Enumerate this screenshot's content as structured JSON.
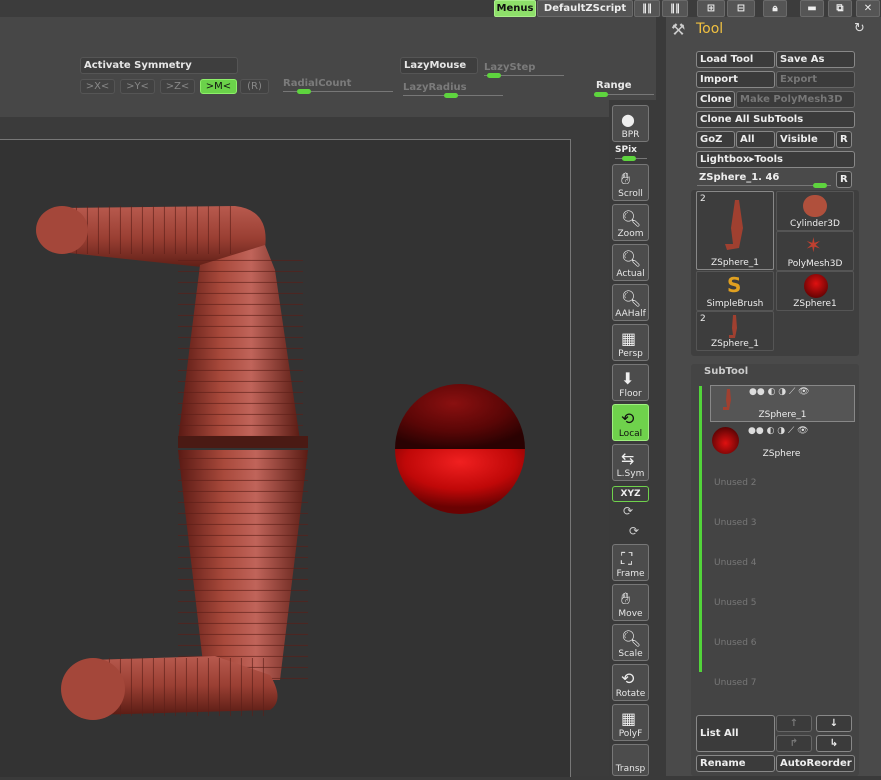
{
  "topbar": {
    "menus": "Menus",
    "script": "DefaultZScript"
  },
  "shelf": {
    "activate_symmetry": "Activate Symmetry",
    "sym_x": ">X<",
    "sym_y": ">Y<",
    "sym_z": ">Z<",
    "sym_m": ">M<",
    "sym_r": "(R)",
    "radial_count": "RadialCount",
    "lazymouse": "LazyMouse",
    "lazystep": "LazyStep",
    "lazyradius": "LazyRadius",
    "range": "Range"
  },
  "right_toolbar": {
    "bpr": "BPR",
    "spix": "SPix",
    "scroll": "Scroll",
    "zoom": "Zoom",
    "actual": "Actual",
    "aahalf": "AAHalf",
    "persp": "Persp",
    "floor": "Floor",
    "local": "Local",
    "lsym": "L.Sym",
    "xyz": "XYZ",
    "frame": "Frame",
    "move": "Move",
    "scale": "Scale",
    "rotate": "Rotate",
    "polyf": "PolyF",
    "transp": "Transp"
  },
  "tool_panel": {
    "title": "Tool",
    "load_tool": "Load Tool",
    "save_as": "Save As",
    "import": "Import",
    "export": "Export",
    "clone": "Clone",
    "make_polymesh": "Make PolyMesh3D",
    "clone_all": "Clone All SubTools",
    "goz": "GoZ",
    "all": "All",
    "visible": "Visible",
    "r": "R",
    "lightbox": "Lightbox▸Tools",
    "current_tool": "ZSphere_1. 46",
    "thumbs": [
      {
        "label": "ZSphere_1",
        "count": "2"
      },
      {
        "label": "Cylinder3D"
      },
      {
        "label": "PolyMesh3D"
      },
      {
        "label": "SimpleBrush"
      },
      {
        "label": "ZSphere1"
      },
      {
        "label": "ZSphere_1",
        "count": "2"
      }
    ]
  },
  "subtool": {
    "title": "SubTool",
    "items": [
      "ZSphere_1",
      "ZSphere",
      "Unused 2",
      "Unused 3",
      "Unused 4",
      "Unused 5",
      "Unused 6",
      "Unused 7"
    ],
    "list_all": "List All",
    "rename": "Rename",
    "autoreorder": "AutoReorder"
  }
}
